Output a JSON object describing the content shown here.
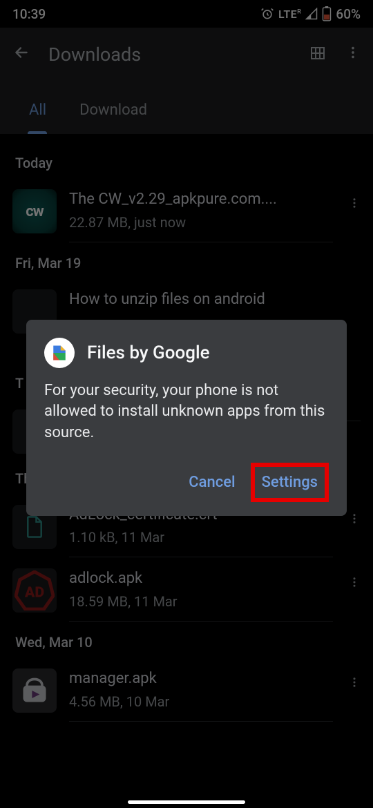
{
  "status": {
    "time": "10:39",
    "lte": "LTE",
    "lte_sup": "R",
    "battery_pct": "60%"
  },
  "appbar": {
    "title": "Downloads"
  },
  "tabs": [
    {
      "label": "All",
      "active": true
    },
    {
      "label": "Download",
      "active": false
    }
  ],
  "sections": [
    {
      "header": "Today",
      "items": [
        {
          "name": "The CW_v2.29_apkpure.com....",
          "sub": "22.87 MB, just now",
          "thumb": "cw"
        }
      ]
    },
    {
      "header": "Fri, Mar 19",
      "items": [
        {
          "name": "How to unzip files on android",
          "sub": "",
          "thumb": "doc"
        }
      ]
    },
    {
      "header": "T",
      "items": []
    },
    {
      "header": "Thu, Mar 11",
      "items": [
        {
          "name": "AdLock_certificate.crt",
          "sub": "1.10 kB, 11 Mar",
          "thumb": "doc"
        },
        {
          "name": "adlock.apk",
          "sub": "18.59 MB, 11 Mar",
          "thumb": "ad"
        }
      ]
    },
    {
      "header": "Wed, Mar 10",
      "items": [
        {
          "name": "manager.apk",
          "sub": "4.56 MB, 10 Mar",
          "thumb": "manager"
        }
      ]
    }
  ],
  "dialog": {
    "app_name": "Files by Google",
    "message": "For your security, your phone is not allowed to install unknown apps from this source.",
    "cancel": "Cancel",
    "settings": "Settings"
  }
}
